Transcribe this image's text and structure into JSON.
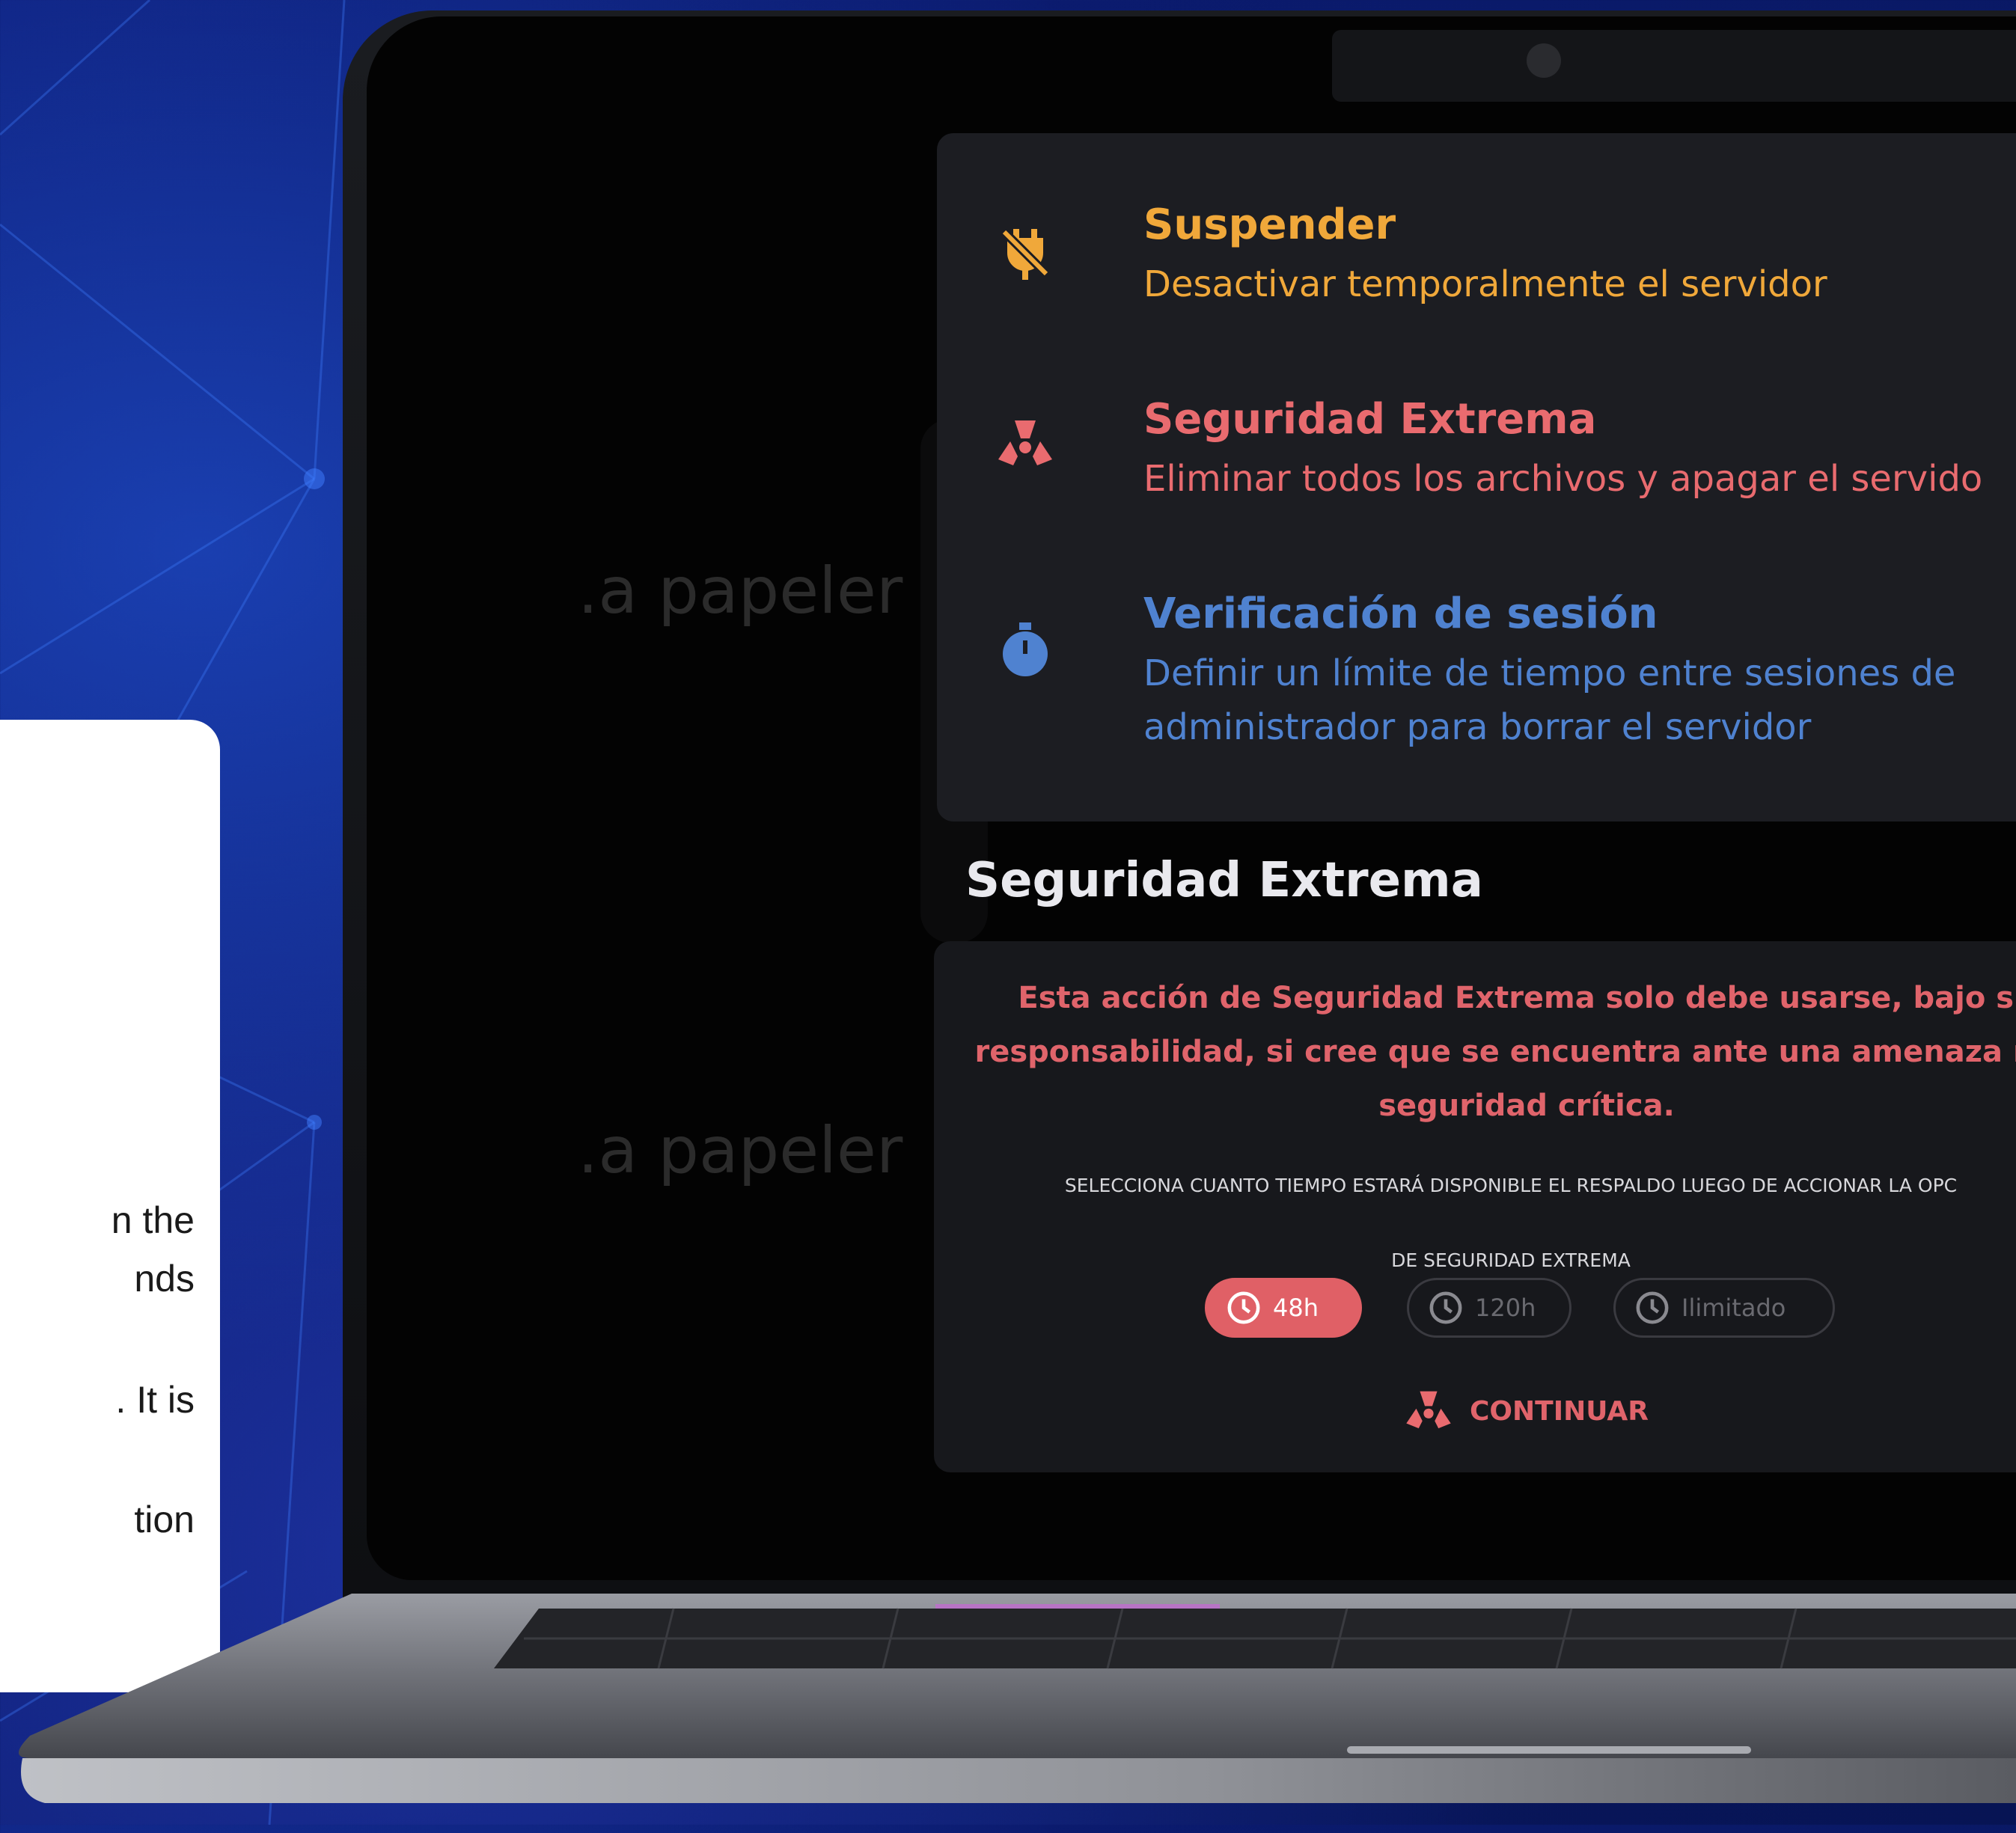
{
  "card": {
    "lines": [
      "n the",
      "nds",
      ". It is",
      "tion"
    ]
  },
  "screen": {
    "ghost_text_1": ".a papeler",
    "ghost_text_2": ".a papeler",
    "options": [
      {
        "title": "Suspender",
        "description": [
          "Desactivar temporalmente el servidor"
        ],
        "color": "#f0a83a",
        "icon": "plug-off-icon"
      },
      {
        "title": "Seguridad Extrema",
        "description": [
          "Eliminar todos los archivos y apagar el servido"
        ],
        "color": "#e96b6f",
        "icon": "radiation-icon"
      },
      {
        "title": "Verificación de sesión",
        "description": [
          "Definir un límite de tiempo entre sesiones de",
          "administrador para borrar el servidor"
        ],
        "color": "#4f82d0",
        "icon": "stopwatch-icon"
      }
    ],
    "section_title": "Seguridad Extrema",
    "warning_lines": [
      "Esta acción de Seguridad Extrema solo debe usarse, bajo su",
      "responsabilidad, si cree que se encuentra ante una amenaza real",
      "seguridad crítica."
    ],
    "select_lines": [
      "SELECCIONA CUANTO TIEMPO ESTARÁ DISPONIBLE EL RESPALDO LUEGO DE ACCIONAR LA OPC",
      "DE SEGURIDAD EXTREMA"
    ],
    "durations": [
      {
        "label": "48h",
        "active": true
      },
      {
        "label": "120h",
        "active": false
      },
      {
        "label": "Ilimitado",
        "active": false
      }
    ],
    "continue_label": "CONTINUAR",
    "accent": "#e06066"
  }
}
